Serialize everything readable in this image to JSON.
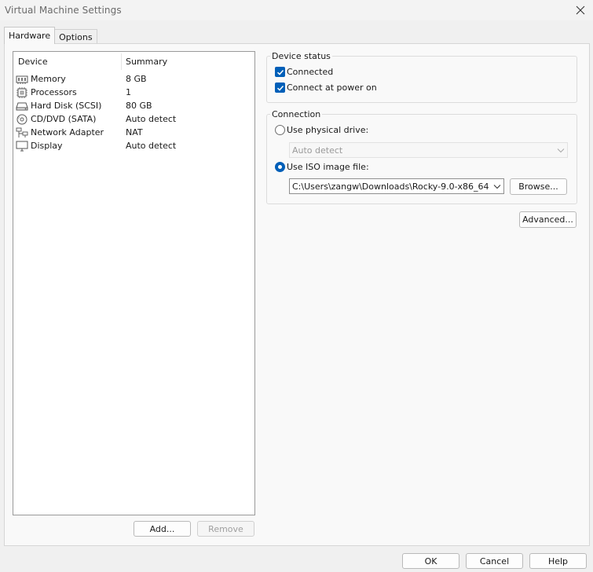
{
  "window": {
    "title": "Virtual Machine Settings"
  },
  "tabs": [
    {
      "label": "Hardware",
      "active": true
    },
    {
      "label": "Options",
      "active": false
    }
  ],
  "device_list": {
    "columns": {
      "device": "Device",
      "summary": "Summary"
    },
    "rows": [
      {
        "icon": "memory-icon",
        "device": "Memory",
        "summary": "8 GB"
      },
      {
        "icon": "processor-icon",
        "device": "Processors",
        "summary": "1"
      },
      {
        "icon": "hard-disk-icon",
        "device": "Hard Disk (SCSI)",
        "summary": "80 GB"
      },
      {
        "icon": "cd-dvd-icon",
        "device": "CD/DVD (SATA)",
        "summary": "Auto detect"
      },
      {
        "icon": "network-adapter-icon",
        "device": "Network Adapter",
        "summary": "NAT"
      },
      {
        "icon": "display-icon",
        "device": "Display",
        "summary": "Auto detect"
      }
    ]
  },
  "list_buttons": {
    "add": "Add...",
    "remove": "Remove"
  },
  "device_status": {
    "title": "Device status",
    "connected": {
      "label": "Connected",
      "checked": true
    },
    "connect_at_power_on": {
      "label": "Connect at power on",
      "checked": true
    }
  },
  "connection": {
    "title": "Connection",
    "physical_drive": {
      "label": "Use physical drive:",
      "selected": false,
      "value": "Auto detect"
    },
    "iso_image": {
      "label": "Use ISO image file:",
      "selected": true,
      "value": "C:\\Users\\zangw\\Downloads\\Rocky-9.0-x86_64"
    },
    "browse": "Browse..."
  },
  "advanced_button": "Advanced...",
  "footer": {
    "ok": "OK",
    "cancel": "Cancel",
    "help": "Help"
  },
  "colors": {
    "accent": "#005fb8",
    "background": "#f0f0f0",
    "panel": "#f9f9f9"
  }
}
